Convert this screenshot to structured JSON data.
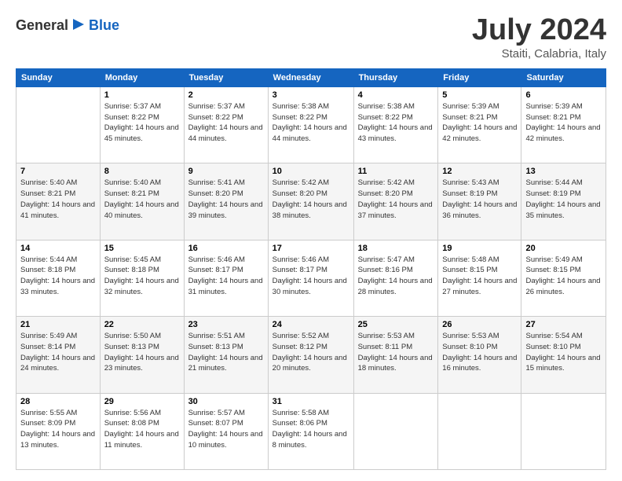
{
  "header": {
    "logo_general": "General",
    "logo_blue": "Blue",
    "title": "July 2024",
    "location": "Staiti, Calabria, Italy"
  },
  "weekdays": [
    "Sunday",
    "Monday",
    "Tuesday",
    "Wednesday",
    "Thursday",
    "Friday",
    "Saturday"
  ],
  "weeks": [
    [
      {
        "day": "",
        "sunrise": "",
        "sunset": "",
        "daylight": ""
      },
      {
        "day": "1",
        "sunrise": "Sunrise: 5:37 AM",
        "sunset": "Sunset: 8:22 PM",
        "daylight": "Daylight: 14 hours and 45 minutes."
      },
      {
        "day": "2",
        "sunrise": "Sunrise: 5:37 AM",
        "sunset": "Sunset: 8:22 PM",
        "daylight": "Daylight: 14 hours and 44 minutes."
      },
      {
        "day": "3",
        "sunrise": "Sunrise: 5:38 AM",
        "sunset": "Sunset: 8:22 PM",
        "daylight": "Daylight: 14 hours and 44 minutes."
      },
      {
        "day": "4",
        "sunrise": "Sunrise: 5:38 AM",
        "sunset": "Sunset: 8:22 PM",
        "daylight": "Daylight: 14 hours and 43 minutes."
      },
      {
        "day": "5",
        "sunrise": "Sunrise: 5:39 AM",
        "sunset": "Sunset: 8:21 PM",
        "daylight": "Daylight: 14 hours and 42 minutes."
      },
      {
        "day": "6",
        "sunrise": "Sunrise: 5:39 AM",
        "sunset": "Sunset: 8:21 PM",
        "daylight": "Daylight: 14 hours and 42 minutes."
      }
    ],
    [
      {
        "day": "7",
        "sunrise": "Sunrise: 5:40 AM",
        "sunset": "Sunset: 8:21 PM",
        "daylight": "Daylight: 14 hours and 41 minutes."
      },
      {
        "day": "8",
        "sunrise": "Sunrise: 5:40 AM",
        "sunset": "Sunset: 8:21 PM",
        "daylight": "Daylight: 14 hours and 40 minutes."
      },
      {
        "day": "9",
        "sunrise": "Sunrise: 5:41 AM",
        "sunset": "Sunset: 8:20 PM",
        "daylight": "Daylight: 14 hours and 39 minutes."
      },
      {
        "day": "10",
        "sunrise": "Sunrise: 5:42 AM",
        "sunset": "Sunset: 8:20 PM",
        "daylight": "Daylight: 14 hours and 38 minutes."
      },
      {
        "day": "11",
        "sunrise": "Sunrise: 5:42 AM",
        "sunset": "Sunset: 8:20 PM",
        "daylight": "Daylight: 14 hours and 37 minutes."
      },
      {
        "day": "12",
        "sunrise": "Sunrise: 5:43 AM",
        "sunset": "Sunset: 8:19 PM",
        "daylight": "Daylight: 14 hours and 36 minutes."
      },
      {
        "day": "13",
        "sunrise": "Sunrise: 5:44 AM",
        "sunset": "Sunset: 8:19 PM",
        "daylight": "Daylight: 14 hours and 35 minutes."
      }
    ],
    [
      {
        "day": "14",
        "sunrise": "Sunrise: 5:44 AM",
        "sunset": "Sunset: 8:18 PM",
        "daylight": "Daylight: 14 hours and 33 minutes."
      },
      {
        "day": "15",
        "sunrise": "Sunrise: 5:45 AM",
        "sunset": "Sunset: 8:18 PM",
        "daylight": "Daylight: 14 hours and 32 minutes."
      },
      {
        "day": "16",
        "sunrise": "Sunrise: 5:46 AM",
        "sunset": "Sunset: 8:17 PM",
        "daylight": "Daylight: 14 hours and 31 minutes."
      },
      {
        "day": "17",
        "sunrise": "Sunrise: 5:46 AM",
        "sunset": "Sunset: 8:17 PM",
        "daylight": "Daylight: 14 hours and 30 minutes."
      },
      {
        "day": "18",
        "sunrise": "Sunrise: 5:47 AM",
        "sunset": "Sunset: 8:16 PM",
        "daylight": "Daylight: 14 hours and 28 minutes."
      },
      {
        "day": "19",
        "sunrise": "Sunrise: 5:48 AM",
        "sunset": "Sunset: 8:15 PM",
        "daylight": "Daylight: 14 hours and 27 minutes."
      },
      {
        "day": "20",
        "sunrise": "Sunrise: 5:49 AM",
        "sunset": "Sunset: 8:15 PM",
        "daylight": "Daylight: 14 hours and 26 minutes."
      }
    ],
    [
      {
        "day": "21",
        "sunrise": "Sunrise: 5:49 AM",
        "sunset": "Sunset: 8:14 PM",
        "daylight": "Daylight: 14 hours and 24 minutes."
      },
      {
        "day": "22",
        "sunrise": "Sunrise: 5:50 AM",
        "sunset": "Sunset: 8:13 PM",
        "daylight": "Daylight: 14 hours and 23 minutes."
      },
      {
        "day": "23",
        "sunrise": "Sunrise: 5:51 AM",
        "sunset": "Sunset: 8:13 PM",
        "daylight": "Daylight: 14 hours and 21 minutes."
      },
      {
        "day": "24",
        "sunrise": "Sunrise: 5:52 AM",
        "sunset": "Sunset: 8:12 PM",
        "daylight": "Daylight: 14 hours and 20 minutes."
      },
      {
        "day": "25",
        "sunrise": "Sunrise: 5:53 AM",
        "sunset": "Sunset: 8:11 PM",
        "daylight": "Daylight: 14 hours and 18 minutes."
      },
      {
        "day": "26",
        "sunrise": "Sunrise: 5:53 AM",
        "sunset": "Sunset: 8:10 PM",
        "daylight": "Daylight: 14 hours and 16 minutes."
      },
      {
        "day": "27",
        "sunrise": "Sunrise: 5:54 AM",
        "sunset": "Sunset: 8:10 PM",
        "daylight": "Daylight: 14 hours and 15 minutes."
      }
    ],
    [
      {
        "day": "28",
        "sunrise": "Sunrise: 5:55 AM",
        "sunset": "Sunset: 8:09 PM",
        "daylight": "Daylight: 14 hours and 13 minutes."
      },
      {
        "day": "29",
        "sunrise": "Sunrise: 5:56 AM",
        "sunset": "Sunset: 8:08 PM",
        "daylight": "Daylight: 14 hours and 11 minutes."
      },
      {
        "day": "30",
        "sunrise": "Sunrise: 5:57 AM",
        "sunset": "Sunset: 8:07 PM",
        "daylight": "Daylight: 14 hours and 10 minutes."
      },
      {
        "day": "31",
        "sunrise": "Sunrise: 5:58 AM",
        "sunset": "Sunset: 8:06 PM",
        "daylight": "Daylight: 14 hours and 8 minutes."
      },
      {
        "day": "",
        "sunrise": "",
        "sunset": "",
        "daylight": ""
      },
      {
        "day": "",
        "sunrise": "",
        "sunset": "",
        "daylight": ""
      },
      {
        "day": "",
        "sunrise": "",
        "sunset": "",
        "daylight": ""
      }
    ]
  ]
}
